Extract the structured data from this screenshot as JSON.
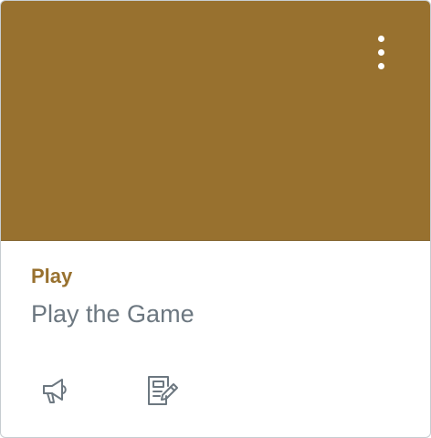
{
  "card": {
    "hero_color": "#98712f",
    "menu_icon": "kebab-vertical-icon",
    "course_code": "Play",
    "course_name": "Play the Game",
    "code_color": "#98712f",
    "name_color": "#6c7780"
  },
  "actions": [
    {
      "icon": "megaphone-icon"
    },
    {
      "icon": "assignment-edit-icon"
    }
  ]
}
